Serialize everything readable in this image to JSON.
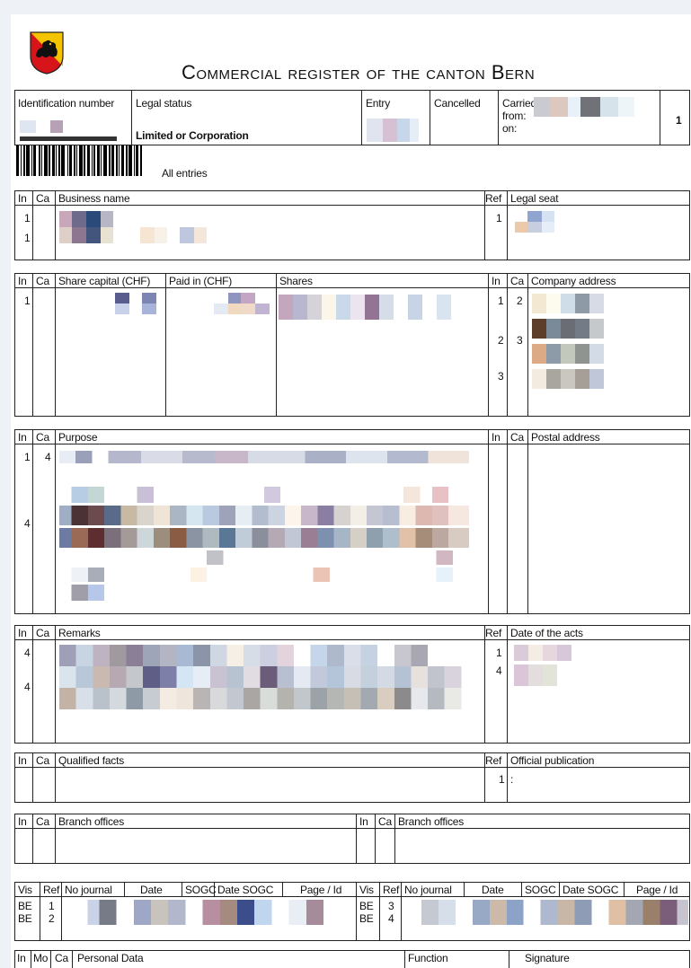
{
  "header": {
    "title": "Commercial register of the canton Bern",
    "coat_of_arms": "bern-bear-shield-icon"
  },
  "top": {
    "identification_number": "Identification number",
    "legal_status": "Legal status",
    "legal_status_value": "Limited or Corporation",
    "entry": "Entry",
    "cancelled": "Cancelled",
    "carried": "Carried",
    "from": "from:",
    "on": "on:",
    "page_no": "1",
    "all_entries": "All entries"
  },
  "sec1": {
    "in": "In",
    "ca": "Ca",
    "business_name": "Business name",
    "ref": "Ref",
    "legal_seat": "Legal seat",
    "rows_in": [
      "1",
      "1"
    ],
    "ref_values": [
      "1"
    ]
  },
  "sec2": {
    "in": "In",
    "ca": "Ca",
    "share_capital": "Share capital (CHF)",
    "paid_in": "Paid in (CHF)",
    "shares": "Shares",
    "in2": "In",
    "ca2": "Ca",
    "company_address": "Company address",
    "row_in": "1",
    "addr_in": [
      "1",
      "2",
      "3"
    ],
    "addr_ca": [
      "2",
      "3"
    ]
  },
  "sec3": {
    "in": "In",
    "ca": "Ca",
    "purpose": "Purpose",
    "in2": "In",
    "ca2": "Ca",
    "postal_address": "Postal address",
    "row_in": [
      "1",
      "4"
    ],
    "row_ca": "4"
  },
  "sec4": {
    "in": "In",
    "ca": "Ca",
    "remarks": "Remarks",
    "ref": "Ref",
    "date_of_acts": "Date of the acts",
    "rows_in": [
      "4",
      "4"
    ],
    "ref_values": [
      "1",
      "4"
    ]
  },
  "sec5": {
    "in": "In",
    "ca": "Ca",
    "qualified_facts": "Qualified facts",
    "ref": "Ref",
    "official_publication": "Official publication",
    "ref_value": "1",
    "colon": ":"
  },
  "sec6": {
    "in": "In",
    "ca": "Ca",
    "branch_offices": "Branch offices",
    "in2": "In",
    "ca2": "Ca",
    "branch_offices2": "Branch offices"
  },
  "sec7": {
    "vis": "Vis",
    "ref": "Ref",
    "no_journal": "No journal",
    "date": "Date",
    "sogc": "SOGC",
    "date_sogc": "Date SOGC",
    "page_id": "Page / Id",
    "vis2": "Vis",
    "ref2": "Ref",
    "no_journal2": "No journal",
    "date2": "Date",
    "sogc2": "SOGC",
    "date_sogc2": "Date SOGC",
    "page_id2": "Page / Id",
    "left_rows": [
      {
        "vis": "BE",
        "ref": "1"
      },
      {
        "vis": "BE",
        "ref": "2"
      }
    ],
    "right_rows": [
      {
        "vis": "BE",
        "ref": "3"
      },
      {
        "vis": "BE",
        "ref": "4"
      }
    ]
  },
  "sec8": {
    "in": "In",
    "mo": "Mo",
    "ca": "Ca",
    "personal_data": "Personal Data",
    "function": "Function",
    "signature": "Signature"
  }
}
